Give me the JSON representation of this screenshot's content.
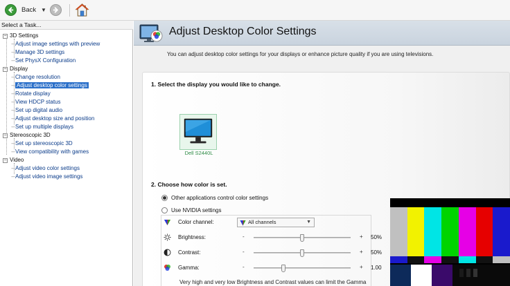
{
  "toolbar": {
    "back_label": "Back"
  },
  "left_panel": {
    "title": "Select a Task...",
    "categories": [
      {
        "label": "3D Settings",
        "items": [
          "Adjust image settings with preview",
          "Manage 3D settings",
          "Set PhysX Configuration"
        ]
      },
      {
        "label": "Display",
        "items": [
          "Change resolution",
          "Adjust desktop color settings",
          "Rotate display",
          "View HDCP status",
          "Set up digital audio",
          "Adjust desktop size and position",
          "Set up multiple displays"
        ]
      },
      {
        "label": "Stereoscopic 3D",
        "items": [
          "Set up stereoscopic 3D",
          "View compatibility with games"
        ]
      },
      {
        "label": "Video",
        "items": [
          "Adjust video color settings",
          "Adjust video image settings"
        ]
      }
    ],
    "selected_item": "Adjust desktop color settings"
  },
  "content": {
    "title": "Adjust Desktop Color Settings",
    "description": "You can adjust desktop color settings for your displays or enhance picture quality if you are using televisions.",
    "section1_title": "1. Select the display you would like to change.",
    "display_name": "Dell S2440L",
    "section2_title": "2. Choose how color is set.",
    "radio_other": "Other applications control color settings",
    "radio_nvidia": "Use NVIDIA settings",
    "selected_radio": "other",
    "color_channel_label": "Color channel:",
    "color_channel_value": "All channels",
    "brightness": {
      "label": "Brightness:",
      "minus": "-",
      "plus": "+",
      "value_text": "50%",
      "level": 0.5
    },
    "contrast": {
      "label": "Contrast:",
      "minus": "-",
      "plus": "+",
      "value_text": "50%",
      "level": 0.5
    },
    "gamma": {
      "label": "Gamma:",
      "minus": "-",
      "plus": "+",
      "value_text": "1.00",
      "level": 0.3
    },
    "note": "Very high and very low Brightness and Contrast values can limit the Gamma range."
  },
  "pattern": {
    "bar_colors": [
      "#c0c0c0",
      "#f2f200",
      "#00e5e5",
      "#00d400",
      "#e600e6",
      "#e60000",
      "#1a1acc"
    ],
    "strip_colors": [
      "#1a1acc",
      "#111111",
      "#e600e6",
      "#111111",
      "#00e5e5",
      "#111111",
      "#c0c0c0"
    ]
  },
  "colors": {
    "selection": "#2a6fc9",
    "link": "#0b3c8a",
    "display_label": "#2d8b45",
    "header_band": "#d0d9e3"
  }
}
